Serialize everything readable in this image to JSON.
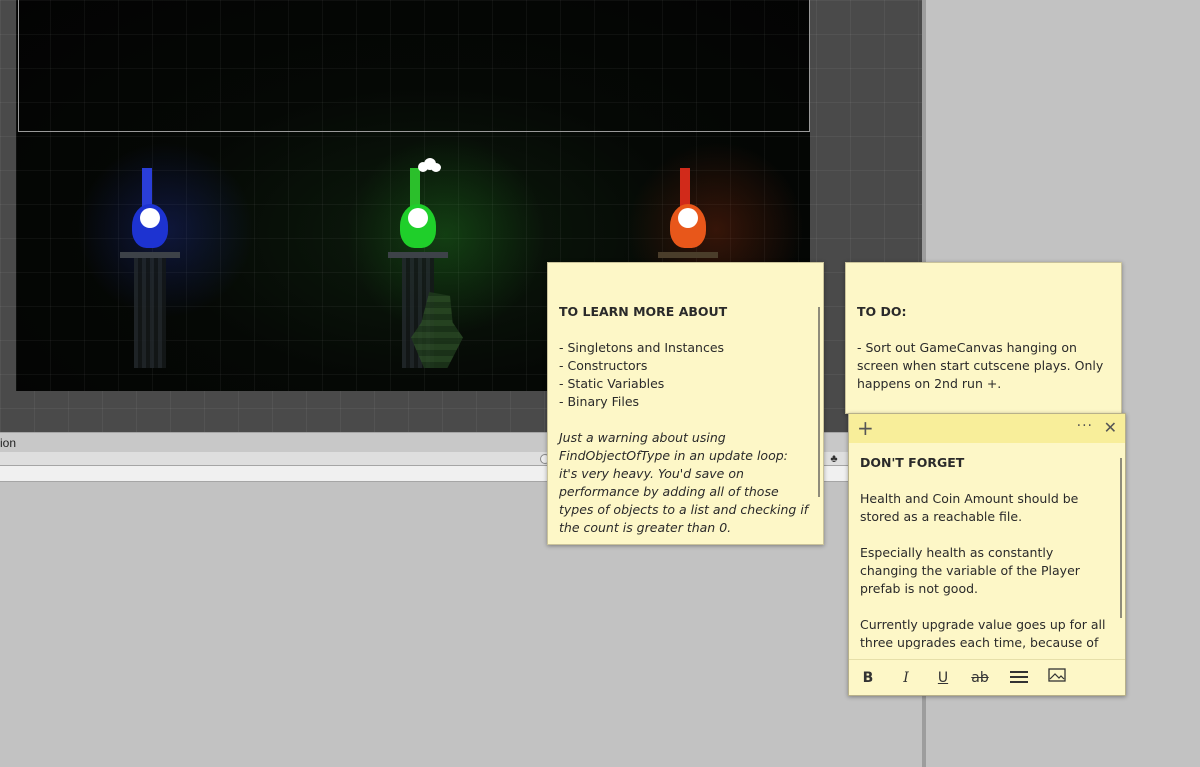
{
  "scene": {
    "torches": [
      {
        "name": "blue",
        "color": "#1d33d1"
      },
      {
        "name": "green",
        "color": "#1fcf2a"
      },
      {
        "name": "red",
        "color": "#e8571a"
      }
    ]
  },
  "panel": {
    "tab_text": "ion"
  },
  "notes": [
    {
      "title": "TO LEARN MORE ABOUT",
      "lines": [
        "- Singletons and Instances",
        "- Constructors",
        "- Static Variables",
        "- Binary Files"
      ],
      "italic_text": "Just a warning about using FindObjectOfType in an update loop: it's very heavy. You'd save on performance by adding all of those types of objects to a list and checking if the count is greater than 0."
    },
    {
      "title": "TO DO:",
      "text": "- Sort out GameCanvas hanging on screen when start cutscene plays. Only happens on 2nd run +."
    },
    {
      "title": "DON'T FORGET",
      "paragraphs": [
        "Health and Coin Amount should be stored as a reachable file.",
        "Especially health as constantly changing the variable of the Player prefab is not good.",
        "Currently upgrade value goes up for all three upgrades each time, because of static variable. Can be sorted by creating individual"
      ],
      "header_icons": {
        "add": "plus-icon",
        "more": "ellipsis-icon",
        "close": "close-icon"
      },
      "toolbar": {
        "bold": "B",
        "italic": "I",
        "underline": "U",
        "strikethrough": "ab"
      }
    }
  ]
}
